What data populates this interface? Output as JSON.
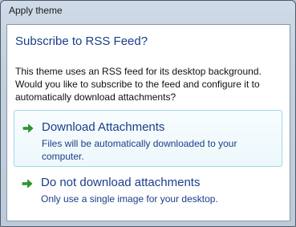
{
  "window": {
    "title": "Apply theme"
  },
  "dialog": {
    "heading": "Subscribe to RSS Feed?",
    "description": "This theme uses an RSS feed for its desktop background. Would you like to subscribe to the feed and configure it to automatically download attachments?"
  },
  "options": [
    {
      "title": "Download Attachments",
      "description": "Files will be automatically downloaded to your computer.",
      "icon": "green-arrow-icon"
    },
    {
      "title": "Do not download attachments",
      "description": "Only use a single image for your desktop.",
      "icon": "green-arrow-icon"
    }
  ],
  "colors": {
    "accent": "#1a3e8a",
    "arrow": "#2a9a2a"
  }
}
